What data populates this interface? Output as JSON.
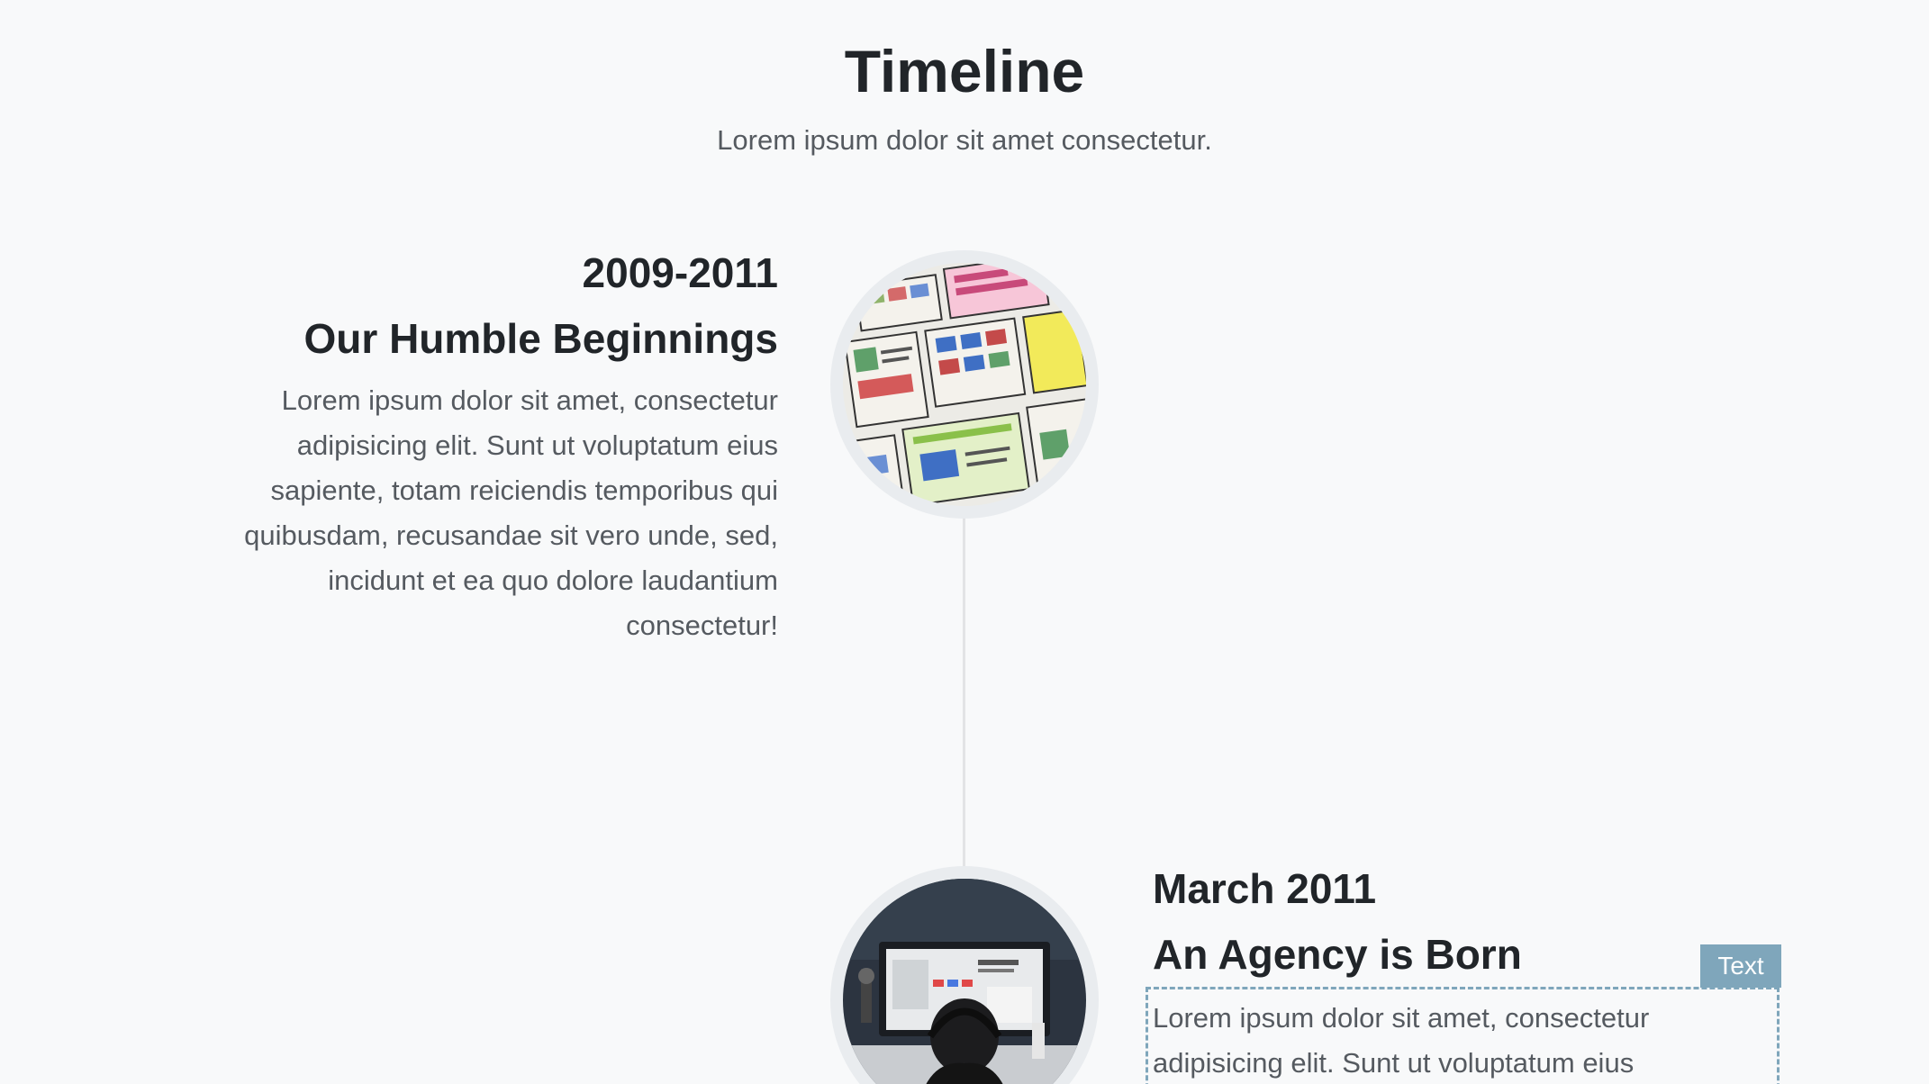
{
  "header": {
    "title": "Timeline",
    "subtitle": "Lorem ipsum dolor sit amet consectetur."
  },
  "timeline": {
    "items": [
      {
        "date": "2009-2011",
        "title": "Our Humble Beginnings",
        "body": "Lorem ipsum dolor sit amet, consectetur adipisicing elit. Sunt ut voluptatum eius sapiente, totam reiciendis temporibus qui quibusdam, recusandae sit vero unde, sed, incidunt et ea quo dolore laudantium consectetur!",
        "image_icon": "sketch-wireframes-image"
      },
      {
        "date": "March 2011",
        "title": "An Agency is Born",
        "body": "Lorem ipsum dolor sit amet, consectetur adipisicing elit. Sunt ut voluptatum eius",
        "image_icon": "person-at-computer-image"
      }
    ]
  },
  "editor": {
    "badge_label": "Text"
  },
  "colors": {
    "background": "#f8f9fa",
    "heading": "#212529",
    "muted_text": "#555a60",
    "editor_accent": "#7fa6bb"
  }
}
